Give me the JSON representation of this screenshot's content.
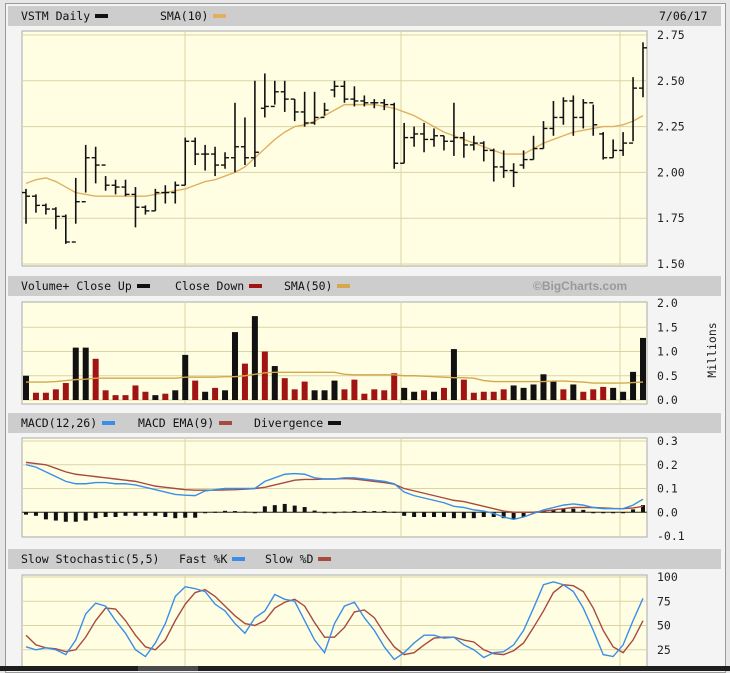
{
  "colors": {
    "plot_bg": "#fffee3",
    "grid": "#d9d4a6",
    "bar": "#111111",
    "sma_price": "#e0b060",
    "vol_up": "#111111",
    "vol_down": "#a01414",
    "vol_sma": "#d4a84b",
    "macd": "#3a8ee8",
    "macd_ema": "#a84a40",
    "divergence": "#111111",
    "fast_k": "#3a8ee8",
    "slow_d": "#a84a40",
    "header_bg": "#cdcdcd"
  },
  "price_panel": {
    "ticker_label": "VSTM Daily",
    "sma_label": "SMA(10)",
    "date": "7/06/17"
  },
  "volume_panel": {
    "label_up": "Volume+ Close Up",
    "label_down": "Close Down",
    "sma_label": "SMA(50)",
    "brand": "©BigCharts.com",
    "unit_label": "Millions"
  },
  "macd_panel": {
    "macd_label": "MACD(12,26)",
    "ema_label": "MACD EMA(9)",
    "div_label": "Divergence"
  },
  "stoch_panel": {
    "label": "Slow Stochastic(5,5)",
    "k_label": "Fast %K",
    "d_label": "Slow %D"
  },
  "chart_data": [
    {
      "type": "ohlc",
      "title": "VSTM Daily",
      "ylim": [
        1.5,
        2.75
      ],
      "yticks": [
        "2.75",
        "2.50",
        "2.25",
        "2.00",
        "1.75",
        "1.50"
      ],
      "open": [
        1.89,
        1.87,
        1.82,
        1.8,
        1.76,
        1.62,
        1.84,
        2.08,
        2.04,
        1.93,
        1.92,
        1.88,
        1.81,
        1.79,
        1.89,
        1.89,
        1.93,
        2.17,
        2.1,
        2.1,
        2.04,
        2.08,
        2.14,
        2.08,
        2.35,
        2.36,
        2.44,
        2.4,
        2.33,
        2.27,
        2.3,
        2.45,
        2.47,
        2.4,
        2.39,
        2.38,
        2.38,
        2.37,
        2.05,
        2.19,
        2.21,
        2.18,
        2.2,
        2.17,
        2.19,
        2.15,
        2.16,
        2.12,
        2.03,
        2.01,
        2.04,
        2.07,
        2.13,
        2.24,
        2.3,
        2.39,
        2.3,
        2.38,
        2.21,
        2.08,
        2.12,
        2.16,
        2.46
      ],
      "high": [
        1.91,
        1.88,
        1.83,
        1.81,
        1.77,
        1.97,
        2.15,
        2.14,
        1.98,
        1.96,
        1.96,
        1.92,
        1.82,
        1.91,
        1.93,
        1.95,
        2.19,
        2.19,
        2.15,
        2.14,
        2.11,
        2.38,
        2.3,
        2.5,
        2.54,
        2.5,
        2.5,
        2.4,
        2.44,
        2.44,
        2.38,
        2.5,
        2.5,
        2.47,
        2.42,
        2.4,
        2.4,
        2.38,
        2.27,
        2.25,
        2.27,
        2.24,
        2.2,
        2.38,
        2.22,
        2.2,
        2.17,
        2.13,
        2.12,
        2.05,
        2.12,
        2.2,
        2.28,
        2.39,
        2.41,
        2.42,
        2.4,
        2.37,
        2.22,
        2.18,
        2.22,
        2.52,
        2.71
      ],
      "low": [
        1.72,
        1.78,
        1.77,
        1.69,
        1.61,
        1.72,
        1.89,
        1.94,
        1.9,
        1.88,
        1.87,
        1.7,
        1.77,
        1.79,
        1.83,
        1.83,
        1.93,
        2.04,
        2.01,
        1.98,
        2.02,
        2.0,
        2.04,
        2.03,
        2.3,
        2.37,
        2.33,
        2.28,
        2.25,
        2.26,
        2.31,
        2.41,
        2.38,
        2.36,
        2.36,
        2.35,
        2.34,
        2.02,
        2.05,
        2.14,
        2.11,
        2.14,
        2.12,
        2.09,
        2.08,
        2.12,
        2.06,
        1.95,
        1.97,
        1.92,
        2.02,
        2.07,
        2.13,
        2.2,
        2.26,
        2.2,
        2.24,
        2.2,
        2.07,
        2.08,
        2.09,
        2.17,
        2.41
      ],
      "close": [
        1.87,
        1.82,
        1.8,
        1.76,
        1.62,
        1.84,
        2.08,
        2.04,
        1.93,
        1.92,
        1.88,
        1.81,
        1.79,
        1.89,
        1.89,
        1.93,
        2.17,
        2.1,
        2.1,
        2.04,
        2.08,
        2.14,
        2.08,
        2.11,
        2.36,
        2.44,
        2.4,
        2.33,
        2.27,
        2.3,
        2.34,
        2.47,
        2.4,
        2.39,
        2.38,
        2.38,
        2.37,
        2.05,
        2.19,
        2.21,
        2.18,
        2.2,
        2.17,
        2.19,
        2.15,
        2.16,
        2.12,
        2.03,
        2.01,
        2.0,
        2.07,
        2.13,
        2.24,
        2.3,
        2.39,
        2.3,
        2.38,
        2.26,
        2.08,
        2.12,
        2.16,
        2.46,
        2.68
      ],
      "sma10": [
        1.94,
        1.96,
        1.97,
        1.95,
        1.92,
        1.89,
        1.88,
        1.87,
        1.87,
        1.87,
        1.87,
        1.87,
        1.87,
        1.88,
        1.89,
        1.9,
        1.91,
        1.93,
        1.95,
        1.96,
        1.98,
        2.0,
        2.03,
        2.08,
        2.13,
        2.18,
        2.22,
        2.25,
        2.26,
        2.28,
        2.31,
        2.34,
        2.37,
        2.37,
        2.37,
        2.37,
        2.36,
        2.35,
        2.33,
        2.31,
        2.28,
        2.25,
        2.22,
        2.2,
        2.18,
        2.16,
        2.14,
        2.12,
        2.1,
        2.1,
        2.1,
        2.13,
        2.16,
        2.18,
        2.2,
        2.22,
        2.23,
        2.24,
        2.25,
        2.25,
        2.26,
        2.28,
        2.31
      ]
    },
    {
      "type": "bar",
      "title": "Volume",
      "ylabel": "Millions",
      "ylim": [
        0,
        2.0
      ],
      "yticks": [
        "2.0",
        "1.5",
        "1.0",
        "0.5",
        "0.0"
      ],
      "values": [
        0.5,
        0.15,
        0.15,
        0.22,
        0.35,
        1.08,
        1.08,
        0.85,
        0.2,
        0.1,
        0.1,
        0.3,
        0.17,
        0.1,
        0.13,
        0.2,
        0.93,
        0.4,
        0.17,
        0.25,
        0.2,
        1.4,
        0.75,
        1.73,
        1.0,
        0.7,
        0.45,
        0.22,
        0.38,
        0.2,
        0.2,
        0.4,
        0.22,
        0.42,
        0.13,
        0.22,
        0.2,
        0.55,
        0.25,
        0.17,
        0.2,
        0.17,
        0.25,
        1.05,
        0.42,
        0.15,
        0.17,
        0.17,
        0.22,
        0.3,
        0.25,
        0.32,
        0.53,
        0.4,
        0.22,
        0.32,
        0.17,
        0.22,
        0.27,
        0.25,
        0.17,
        0.58,
        1.28
      ],
      "close_up": [
        1,
        0,
        0,
        0,
        0,
        1,
        1,
        0,
        0,
        0,
        0,
        0,
        0,
        1,
        0,
        1,
        1,
        0,
        1,
        0,
        1,
        1,
        0,
        1,
        0,
        1,
        0,
        0,
        0,
        1,
        1,
        1,
        0,
        0,
        0,
        0,
        0,
        0,
        1,
        1,
        0,
        1,
        0,
        1,
        0,
        0,
        0,
        0,
        0,
        1,
        1,
        1,
        1,
        1,
        0,
        1,
        0,
        0,
        0,
        1,
        1,
        1,
        1
      ],
      "sma50": [
        0.37,
        0.37,
        0.37,
        0.38,
        0.4,
        0.42,
        0.43,
        0.45,
        0.45,
        0.45,
        0.45,
        0.45,
        0.45,
        0.45,
        0.45,
        0.45,
        0.47,
        0.47,
        0.47,
        0.47,
        0.48,
        0.48,
        0.5,
        0.53,
        0.56,
        0.57,
        0.57,
        0.57,
        0.57,
        0.57,
        0.57,
        0.57,
        0.53,
        0.52,
        0.52,
        0.52,
        0.52,
        0.52,
        0.5,
        0.5,
        0.49,
        0.48,
        0.47,
        0.46,
        0.46,
        0.45,
        0.4,
        0.38,
        0.38,
        0.38,
        0.38,
        0.38,
        0.38,
        0.39,
        0.39,
        0.38,
        0.37,
        0.35,
        0.35,
        0.35,
        0.35,
        0.36,
        0.37
      ]
    },
    {
      "type": "line",
      "title": "MACD(12,26)",
      "ylim": [
        -0.1,
        0.3
      ],
      "yticks": [
        "0.3",
        "0.2",
        "0.1",
        "0.0",
        "-0.1"
      ],
      "macd": [
        0.2,
        0.19,
        0.17,
        0.15,
        0.13,
        0.12,
        0.12,
        0.125,
        0.125,
        0.12,
        0.12,
        0.115,
        0.105,
        0.095,
        0.085,
        0.075,
        0.072,
        0.07,
        0.09,
        0.095,
        0.1,
        0.1,
        0.1,
        0.1,
        0.13,
        0.145,
        0.16,
        0.163,
        0.16,
        0.145,
        0.14,
        0.14,
        0.145,
        0.145,
        0.14,
        0.135,
        0.13,
        0.12,
        0.085,
        0.07,
        0.06,
        0.05,
        0.04,
        0.025,
        0.02,
        0.01,
        0.005,
        -0.005,
        -0.02,
        -0.03,
        -0.02,
        -0.005,
        0.01,
        0.02,
        0.03,
        0.035,
        0.03,
        0.02,
        0.015,
        0.015,
        0.015,
        0.03,
        0.055
      ],
      "ema9": [
        0.21,
        0.205,
        0.2,
        0.185,
        0.17,
        0.16,
        0.155,
        0.15,
        0.145,
        0.14,
        0.135,
        0.13,
        0.12,
        0.11,
        0.105,
        0.1,
        0.095,
        0.093,
        0.093,
        0.093,
        0.094,
        0.095,
        0.097,
        0.1,
        0.105,
        0.115,
        0.125,
        0.135,
        0.138,
        0.138,
        0.14,
        0.14,
        0.142,
        0.14,
        0.135,
        0.13,
        0.125,
        0.118,
        0.1,
        0.09,
        0.08,
        0.07,
        0.06,
        0.05,
        0.045,
        0.035,
        0.025,
        0.015,
        0.005,
        0,
        0,
        0,
        0.005,
        0.01,
        0.015,
        0.02,
        0.02,
        0.02,
        0.018,
        0.016,
        0.015,
        0.018,
        0.025
      ],
      "divergence": [
        -0.01,
        -0.015,
        -0.03,
        -0.035,
        -0.04,
        -0.04,
        -0.035,
        -0.025,
        -0.02,
        -0.02,
        -0.015,
        -0.015,
        -0.015,
        -0.015,
        -0.02,
        -0.025,
        -0.023,
        -0.023,
        -0.003,
        0.002,
        0.006,
        0.005,
        0.003,
        0,
        0.025,
        0.03,
        0.035,
        0.028,
        0.022,
        0.007,
        0,
        0,
        0.003,
        0.005,
        0.005,
        0.005,
        0.005,
        0.002,
        -0.015,
        -0.02,
        -0.02,
        -0.02,
        -0.02,
        -0.025,
        -0.025,
        -0.025,
        -0.02,
        -0.02,
        -0.025,
        -0.03,
        -0.02,
        -0.005,
        0.005,
        0.01,
        0.015,
        0.015,
        0.01,
        0,
        -0.003,
        -0.001,
        0,
        0.012,
        0.03
      ]
    },
    {
      "type": "line",
      "title": "Slow Stochastic(5,5)",
      "ylim": [
        0,
        100
      ],
      "yticks": [
        "100",
        "75",
        "50",
        "25"
      ],
      "fast_k": [
        28,
        25,
        27,
        25,
        20,
        35,
        62,
        73,
        70,
        55,
        42,
        25,
        18,
        32,
        52,
        80,
        90,
        88,
        85,
        72,
        65,
        52,
        42,
        58,
        65,
        82,
        77,
        75,
        55,
        35,
        22,
        52,
        70,
        74,
        58,
        45,
        28,
        15,
        22,
        32,
        40,
        40,
        37,
        38,
        30,
        25,
        17,
        22,
        23,
        30,
        45,
        68,
        92,
        95,
        92,
        85,
        68,
        45,
        20,
        18,
        30,
        55,
        78
      ],
      "slow_d": [
        40,
        30,
        27,
        26,
        23,
        25,
        38,
        55,
        68,
        67,
        55,
        40,
        28,
        25,
        35,
        55,
        72,
        84,
        87,
        80,
        70,
        60,
        52,
        50,
        55,
        68,
        74,
        77,
        70,
        53,
        38,
        38,
        48,
        64,
        66,
        58,
        42,
        28,
        20,
        22,
        30,
        37,
        38,
        38,
        35,
        33,
        25,
        21,
        20,
        24,
        32,
        48,
        65,
        84,
        92,
        91,
        85,
        68,
        45,
        28,
        22,
        35,
        55
      ]
    }
  ]
}
